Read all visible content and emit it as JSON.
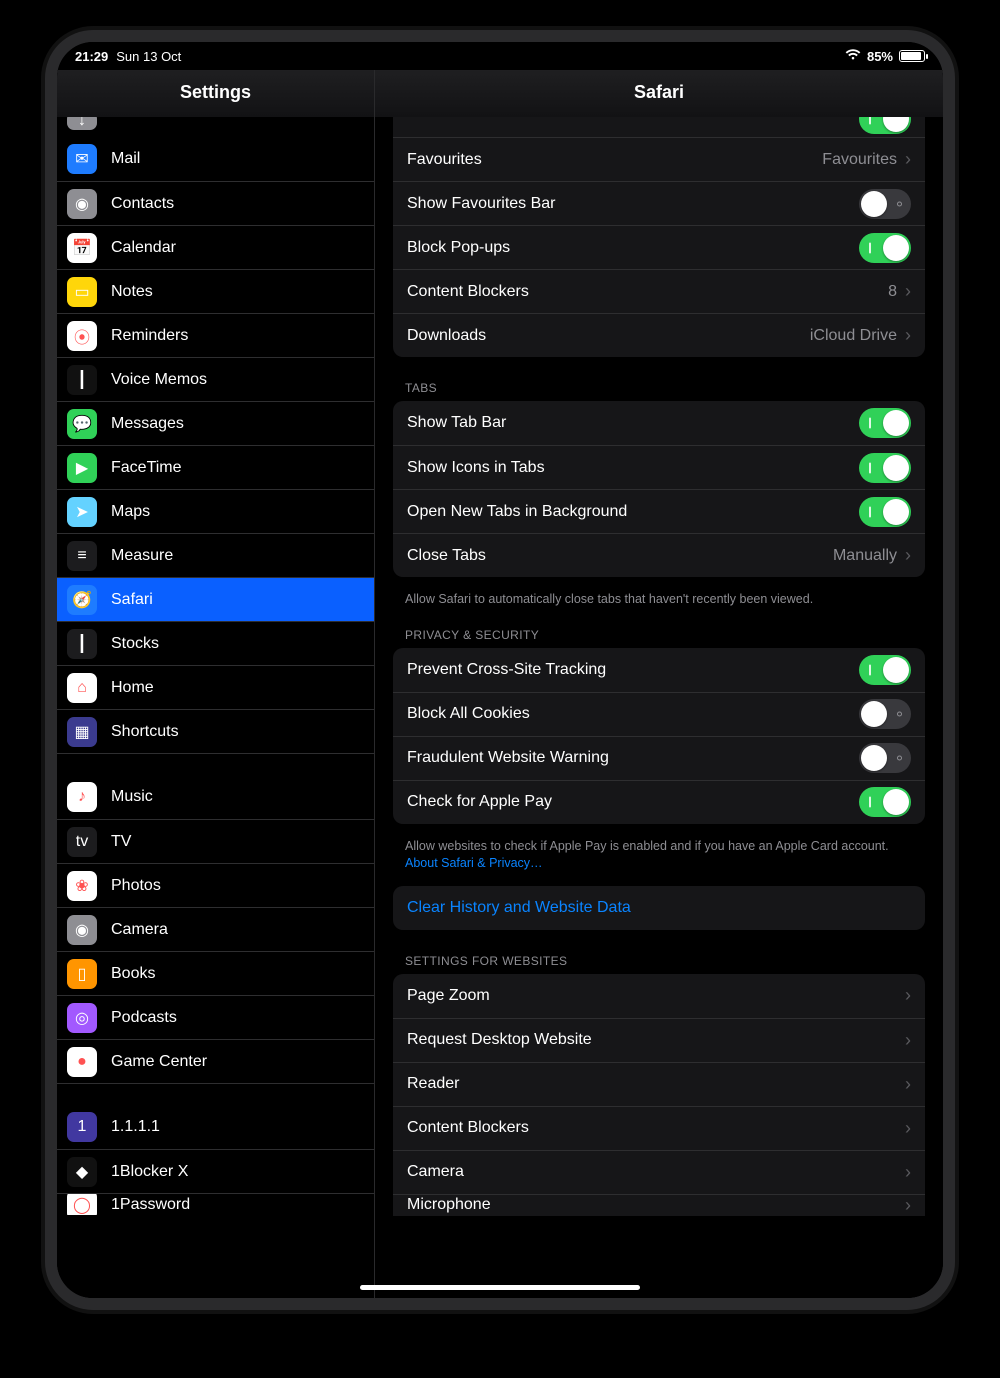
{
  "status": {
    "time": "21:29",
    "date": "Sun 13 Oct",
    "battery_pct": "85%"
  },
  "sidebar": {
    "title": "Settings",
    "items": [
      {
        "label": "Mail",
        "color": "#1e7cff",
        "glyph": "✉"
      },
      {
        "label": "Contacts",
        "color": "#8e8e93",
        "glyph": "◉"
      },
      {
        "label": "Calendar",
        "color": "#ffffff",
        "glyph": "📅",
        "dark": true
      },
      {
        "label": "Notes",
        "color": "#ffd60a",
        "glyph": "▭"
      },
      {
        "label": "Reminders",
        "color": "#ffffff",
        "glyph": "⦿",
        "dark": true
      },
      {
        "label": "Voice Memos",
        "color": "#111111",
        "glyph": "┃"
      },
      {
        "label": "Messages",
        "color": "#30d158",
        "glyph": "💬"
      },
      {
        "label": "FaceTime",
        "color": "#30d158",
        "glyph": "▶"
      },
      {
        "label": "Maps",
        "color": "#64d2ff",
        "glyph": "➤"
      },
      {
        "label": "Measure",
        "color": "#1c1c1e",
        "glyph": "≡"
      },
      {
        "label": "Safari",
        "color": "#1e7cff",
        "glyph": "🧭",
        "selected": true
      },
      {
        "label": "Stocks",
        "color": "#1c1c1e",
        "glyph": "┃"
      },
      {
        "label": "Home",
        "color": "#ffffff",
        "glyph": "⌂",
        "dark": true
      },
      {
        "label": "Shortcuts",
        "color": "#3b3b8f",
        "glyph": "▦"
      }
    ],
    "items2": [
      {
        "label": "Music",
        "color": "#ffffff",
        "glyph": "♪",
        "dark": true
      },
      {
        "label": "TV",
        "color": "#1c1c1e",
        "glyph": "tv"
      },
      {
        "label": "Photos",
        "color": "#ffffff",
        "glyph": "❀",
        "dark": true
      },
      {
        "label": "Camera",
        "color": "#8e8e93",
        "glyph": "◉"
      },
      {
        "label": "Books",
        "color": "#ff9500",
        "glyph": "▯"
      },
      {
        "label": "Podcasts",
        "color": "#a259ff",
        "glyph": "◎"
      },
      {
        "label": "Game Center",
        "color": "#ffffff",
        "glyph": "●",
        "dark": true
      }
    ],
    "items3": [
      {
        "label": "1.1.1.1",
        "color": "#4138a0",
        "glyph": "1"
      },
      {
        "label": "1Blocker X",
        "color": "#111111",
        "glyph": "◆"
      },
      {
        "label": "1Password",
        "color": "#ffffff",
        "glyph": "◯",
        "dark": true
      }
    ]
  },
  "detail": {
    "title": "Safari",
    "general": {
      "favourites_label": "Favourites",
      "favourites_value": "Favourites",
      "favbar_label": "Show Favourites Bar",
      "favbar_on": false,
      "popups_label": "Block Pop-ups",
      "popups_on": true,
      "blockers_label": "Content Blockers",
      "blockers_value": "8",
      "downloads_label": "Downloads",
      "downloads_value": "iCloud Drive",
      "top_toggle_on": true
    },
    "tabs": {
      "header": "Tabs",
      "tabbar_label": "Show Tab Bar",
      "tabbar_on": true,
      "icons_label": "Show Icons in Tabs",
      "icons_on": true,
      "bg_label": "Open New Tabs in Background",
      "bg_on": true,
      "close_label": "Close Tabs",
      "close_value": "Manually",
      "footer": "Allow Safari to automatically close tabs that haven't recently been viewed."
    },
    "privacy": {
      "header": "Privacy & Security",
      "crosssite_label": "Prevent Cross-Site Tracking",
      "crosssite_on": true,
      "cookies_label": "Block All Cookies",
      "cookies_on": false,
      "fraud_label": "Fraudulent Website Warning",
      "fraud_on": false,
      "applepay_label": "Check for Apple Pay",
      "applepay_on": true,
      "footer": "Allow websites to check if Apple Pay is enabled and if you have an Apple Card account.",
      "link": "About Safari & Privacy…"
    },
    "clear_label": "Clear History and Website Data",
    "websites": {
      "header": "Settings for Websites",
      "rows": [
        {
          "label": "Page Zoom"
        },
        {
          "label": "Request Desktop Website"
        },
        {
          "label": "Reader"
        },
        {
          "label": "Content Blockers"
        },
        {
          "label": "Camera"
        },
        {
          "label": "Microphone"
        }
      ]
    }
  }
}
